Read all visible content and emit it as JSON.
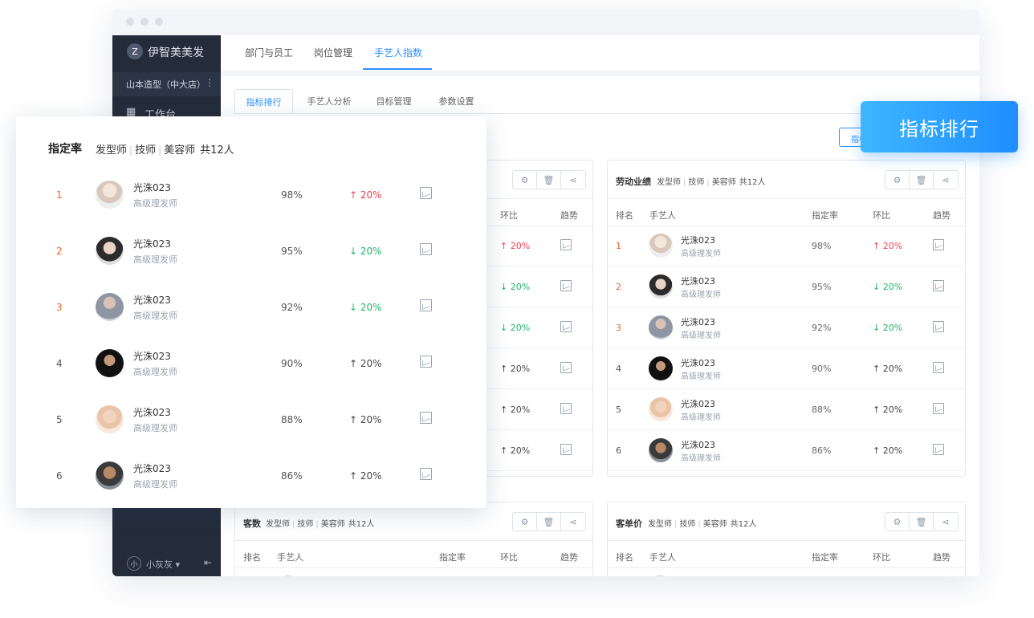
{
  "sidebar": {
    "brand_logo": "Z",
    "brand_name": "伊智美美发",
    "store": "山本造型（中大店）",
    "store_more": "⋮",
    "menu_icon": "dashboard-icon",
    "menu_label": "工作台",
    "user_avatar": "小",
    "user_name": "小灰灰 ▾",
    "collapse_icon": "⇤"
  },
  "topnav": {
    "items": [
      "部门与员工",
      "岗位管理",
      "手艺人指数"
    ],
    "active_index": 2
  },
  "subtabs": {
    "items": [
      "指标排行",
      "手艺人分析",
      "目标管理",
      "参数设置"
    ],
    "active_index": 0,
    "small_button": "指标"
  },
  "filters": [
    "发型师",
    "技师",
    "美容师",
    "共12人"
  ],
  "columns": [
    "排名",
    "手艺人",
    "指定率",
    "环比",
    "趋势"
  ],
  "cards": {
    "left_top": {
      "title": ""
    },
    "right_top": {
      "title": "劳动业绩"
    },
    "left_bottom": {
      "title": "客数"
    },
    "right_bottom": {
      "title": "客单价"
    }
  },
  "rows": [
    {
      "rank": "1",
      "name": "光洙023",
      "role": "高级理发师",
      "rate": "98%",
      "change": "↑ 20%",
      "trend": "up-red"
    },
    {
      "rank": "2",
      "name": "光洙023",
      "role": "高级理发师",
      "rate": "95%",
      "change": "↓ 20%",
      "trend": "down-green"
    },
    {
      "rank": "3",
      "name": "光洙023",
      "role": "高级理发师",
      "rate": "92%",
      "change": "↓ 20%",
      "trend": "down-green"
    },
    {
      "rank": "4",
      "name": "光洙023",
      "role": "高级理发师",
      "rate": "90%",
      "change": "↑ 20%",
      "trend": "up-dark"
    },
    {
      "rank": "5",
      "name": "光洙023",
      "role": "高级理发师",
      "rate": "88%",
      "change": "↑ 20%",
      "trend": "up-dark"
    },
    {
      "rank": "6",
      "name": "光洙023",
      "role": "高级理发师",
      "rate": "86%",
      "change": "↑ 20%",
      "trend": "up-dark"
    }
  ],
  "overlay": {
    "title": "指定率"
  },
  "callout": "指标排行",
  "icons": {
    "settings": "gear-icon",
    "delete": "trash-icon",
    "share": "share-icon",
    "trend": "trend-chart-icon"
  },
  "colors": {
    "accent": "#2b8fff",
    "rank_top": "#f0621f",
    "up": "#f5414f",
    "down": "#21b46a",
    "sidebar": "#242c3a"
  }
}
